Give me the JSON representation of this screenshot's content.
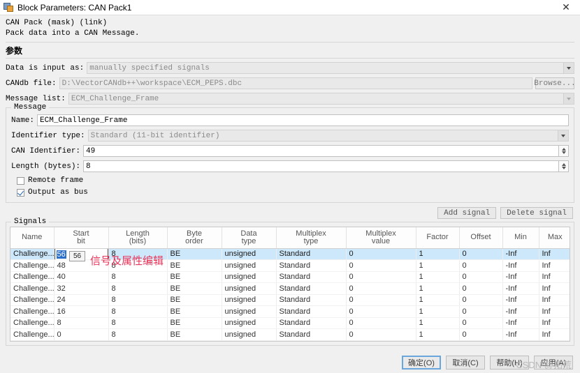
{
  "window": {
    "title": "Block Parameters: CAN Pack1",
    "close_label": "✕",
    "icon": "simulink-block-icon"
  },
  "description": {
    "line1": "CAN Pack (mask) (link)",
    "line2": "Pack data into a CAN Message."
  },
  "params": {
    "group_label": "参数",
    "data_input_label": "Data is input as:",
    "data_input_value": "manually specified signals",
    "candb_label": "CANdb file:",
    "candb_value": "D:\\VectorCANdb++\\workspace\\ECM_PEPS.dbc",
    "browse_label": "Browse...",
    "message_list_label": "Message list:",
    "message_list_value": "ECM_Challenge_Frame"
  },
  "message": {
    "legend": "Message",
    "name_label": "Name:",
    "name_value": "ECM_Challenge_Frame",
    "identifier_type_label": "Identifier type:",
    "identifier_type_value": "Standard (11-bit identifier)",
    "can_identifier_label": "CAN Identifier:",
    "can_identifier_value": "49",
    "length_label": "Length (bytes):",
    "length_value": "8",
    "remote_frame_label": "Remote frame",
    "remote_frame_checked": false,
    "output_as_bus_label": "Output as bus",
    "output_as_bus_checked": true
  },
  "signal_buttons": {
    "add_label": "Add signal",
    "delete_label": "Delete signal"
  },
  "signals": {
    "legend": "Signals",
    "columns": [
      {
        "l1": "Name",
        "l2": ""
      },
      {
        "l1": "Start",
        "l2": "bit"
      },
      {
        "l1": "Length",
        "l2": "(bits)"
      },
      {
        "l1": "Byte",
        "l2": "order"
      },
      {
        "l1": "Data",
        "l2": "type"
      },
      {
        "l1": "Multiplex",
        "l2": "type"
      },
      {
        "l1": "Multiplex",
        "l2": "value"
      },
      {
        "l1": "Factor",
        "l2": ""
      },
      {
        "l1": "Offset",
        "l2": ""
      },
      {
        "l1": "Min",
        "l2": ""
      },
      {
        "l1": "Max",
        "l2": ""
      }
    ],
    "rows": [
      {
        "name": "Challenge...",
        "start_bit": "56",
        "length": "8",
        "byte_order": "BE",
        "data_type": "unsigned",
        "mux_type": "Standard",
        "mux_value": "0",
        "factor": "1",
        "offset": "0",
        "min": "-Inf",
        "max": "Inf",
        "selected": true,
        "editing": true
      },
      {
        "name": "Challenge...",
        "start_bit": "48",
        "length": "8",
        "byte_order": "BE",
        "data_type": "unsigned",
        "mux_type": "Standard",
        "mux_value": "0",
        "factor": "1",
        "offset": "0",
        "min": "-Inf",
        "max": "Inf",
        "selected": false,
        "editing": false
      },
      {
        "name": "Challenge...",
        "start_bit": "40",
        "length": "8",
        "byte_order": "BE",
        "data_type": "unsigned",
        "mux_type": "Standard",
        "mux_value": "0",
        "factor": "1",
        "offset": "0",
        "min": "-Inf",
        "max": "Inf",
        "selected": false,
        "editing": false
      },
      {
        "name": "Challenge...",
        "start_bit": "32",
        "length": "8",
        "byte_order": "BE",
        "data_type": "unsigned",
        "mux_type": "Standard",
        "mux_value": "0",
        "factor": "1",
        "offset": "0",
        "min": "-Inf",
        "max": "Inf",
        "selected": false,
        "editing": false
      },
      {
        "name": "Challenge...",
        "start_bit": "24",
        "length": "8",
        "byte_order": "BE",
        "data_type": "unsigned",
        "mux_type": "Standard",
        "mux_value": "0",
        "factor": "1",
        "offset": "0",
        "min": "-Inf",
        "max": "Inf",
        "selected": false,
        "editing": false
      },
      {
        "name": "Challenge...",
        "start_bit": "16",
        "length": "8",
        "byte_order": "BE",
        "data_type": "unsigned",
        "mux_type": "Standard",
        "mux_value": "0",
        "factor": "1",
        "offset": "0",
        "min": "-Inf",
        "max": "Inf",
        "selected": false,
        "editing": false
      },
      {
        "name": "Challenge...",
        "start_bit": "8",
        "length": "8",
        "byte_order": "BE",
        "data_type": "unsigned",
        "mux_type": "Standard",
        "mux_value": "0",
        "factor": "1",
        "offset": "0",
        "min": "-Inf",
        "max": "Inf",
        "selected": false,
        "editing": false
      },
      {
        "name": "Challenge...",
        "start_bit": "0",
        "length": "8",
        "byte_order": "BE",
        "data_type": "unsigned",
        "mux_type": "Standard",
        "mux_value": "0",
        "factor": "1",
        "offset": "0",
        "min": "-Inf",
        "max": "Inf",
        "selected": false,
        "editing": false
      }
    ]
  },
  "overlay": {
    "tooltip_text": "56",
    "annotation_text": "信号及属性编辑",
    "annotation_color": "#e8345a",
    "watermark_text": "CSDN @拓荒"
  },
  "footer": {
    "ok_label": "确定(O)",
    "cancel_label": "取消(C)",
    "help_label": "帮助(H)",
    "apply_label": "应用(A)"
  }
}
